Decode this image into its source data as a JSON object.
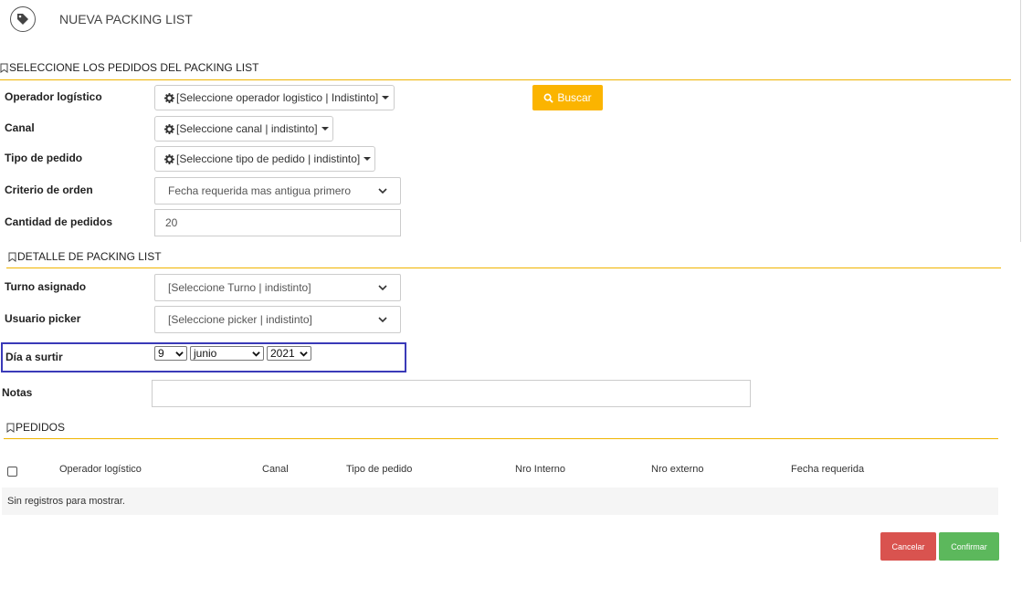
{
  "header": {
    "title": "NUEVA PACKING LIST",
    "icon": "tag-icon"
  },
  "sections": {
    "pedidos_select": "SELECCIONE LOS PEDIDOS DEL PACKING LIST",
    "detalle": "DETALLE DE PACKING LIST",
    "pedidos": "PEDIDOS"
  },
  "form": {
    "operador": {
      "label": "Operador logístico",
      "value": "[Seleccione operador logistico | Indistinto]"
    },
    "canal": {
      "label": "Canal",
      "value": "[Seleccione canal | indistinto]"
    },
    "tipo": {
      "label": "Tipo de pedido",
      "value": "[Seleccione tipo de pedido | indistinto]"
    },
    "criterio": {
      "label": "Criterio de orden",
      "value": "Fecha requerida mas antigua primero"
    },
    "cantidad": {
      "label": "Cantidad de pedidos",
      "value": "20"
    },
    "buscar_label": "Buscar"
  },
  "detalle": {
    "turno": {
      "label": "Turno asignado",
      "value": "[Seleccione Turno | indistinto]"
    },
    "picker": {
      "label": "Usuario picker",
      "value": "[Seleccione picker | indistinto]"
    },
    "dia": {
      "label": "Día a surtir",
      "day": "9",
      "month": "junio",
      "year": "2021"
    },
    "notas": {
      "label": "Notas",
      "value": ""
    }
  },
  "table": {
    "columns": [
      "Operador logístico",
      "Canal",
      "Tipo de pedido",
      "Nro Interno",
      "Nro externo",
      "Fecha requerida"
    ],
    "empty_message": "Sin registros para mostrar."
  },
  "actions": {
    "cancel": "Cancelar",
    "confirm": "Confirmar"
  },
  "colors": {
    "accent": "#fbb400",
    "highlight": "#3a3ab8",
    "cancel": "#d9534f",
    "confirm": "#5cb85c"
  }
}
